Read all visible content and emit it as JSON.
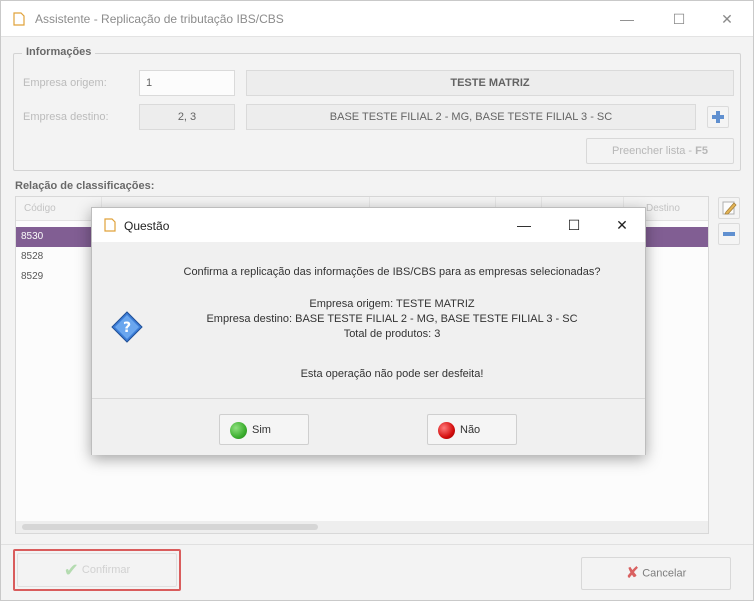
{
  "window": {
    "title": "Assistente - Replicação de tributação IBS/CBS",
    "minimize": "—",
    "maximize": "☐",
    "close": "✕"
  },
  "informacoes": {
    "title": "Informações",
    "origem_label": "Empresa origem:",
    "origem_code": "1",
    "origem_name": "TESTE MATRIZ",
    "destino_label": "Empresa destino:",
    "destino_codes": "2, 3",
    "destino_names": "BASE TESTE FILIAL 2 - MG, BASE TESTE FILIAL 3 - SC",
    "preencher_label": "Preencher lista -",
    "preencher_key": "F5"
  },
  "grid": {
    "section_label": "Relação de classificações:",
    "columns": [
      "Código",
      "",
      "",
      "",
      "",
      "Destino"
    ],
    "rows": [
      "8530",
      "8528",
      "8529"
    ]
  },
  "dialog": {
    "title": "Questão",
    "question": "Confirma a replicação das informações de IBS/CBS para as empresas selecionadas?",
    "origem": "Empresa origem: TESTE MATRIZ",
    "destino": "Empresa destino: BASE TESTE FILIAL 2 - MG, BASE TESTE FILIAL 3 - SC",
    "total": "Total de produtos: 3",
    "warning": "Esta operação não pode ser desfeita!",
    "yes": "Sim",
    "no": "Não"
  },
  "footer": {
    "confirm": "Confirmar",
    "cancel": "Cancelar"
  },
  "colors": {
    "selected_row": "#5b2d73",
    "yes_green": "#3cae2f",
    "no_red": "#d40e0e",
    "highlight_border": "#d12a2a"
  }
}
